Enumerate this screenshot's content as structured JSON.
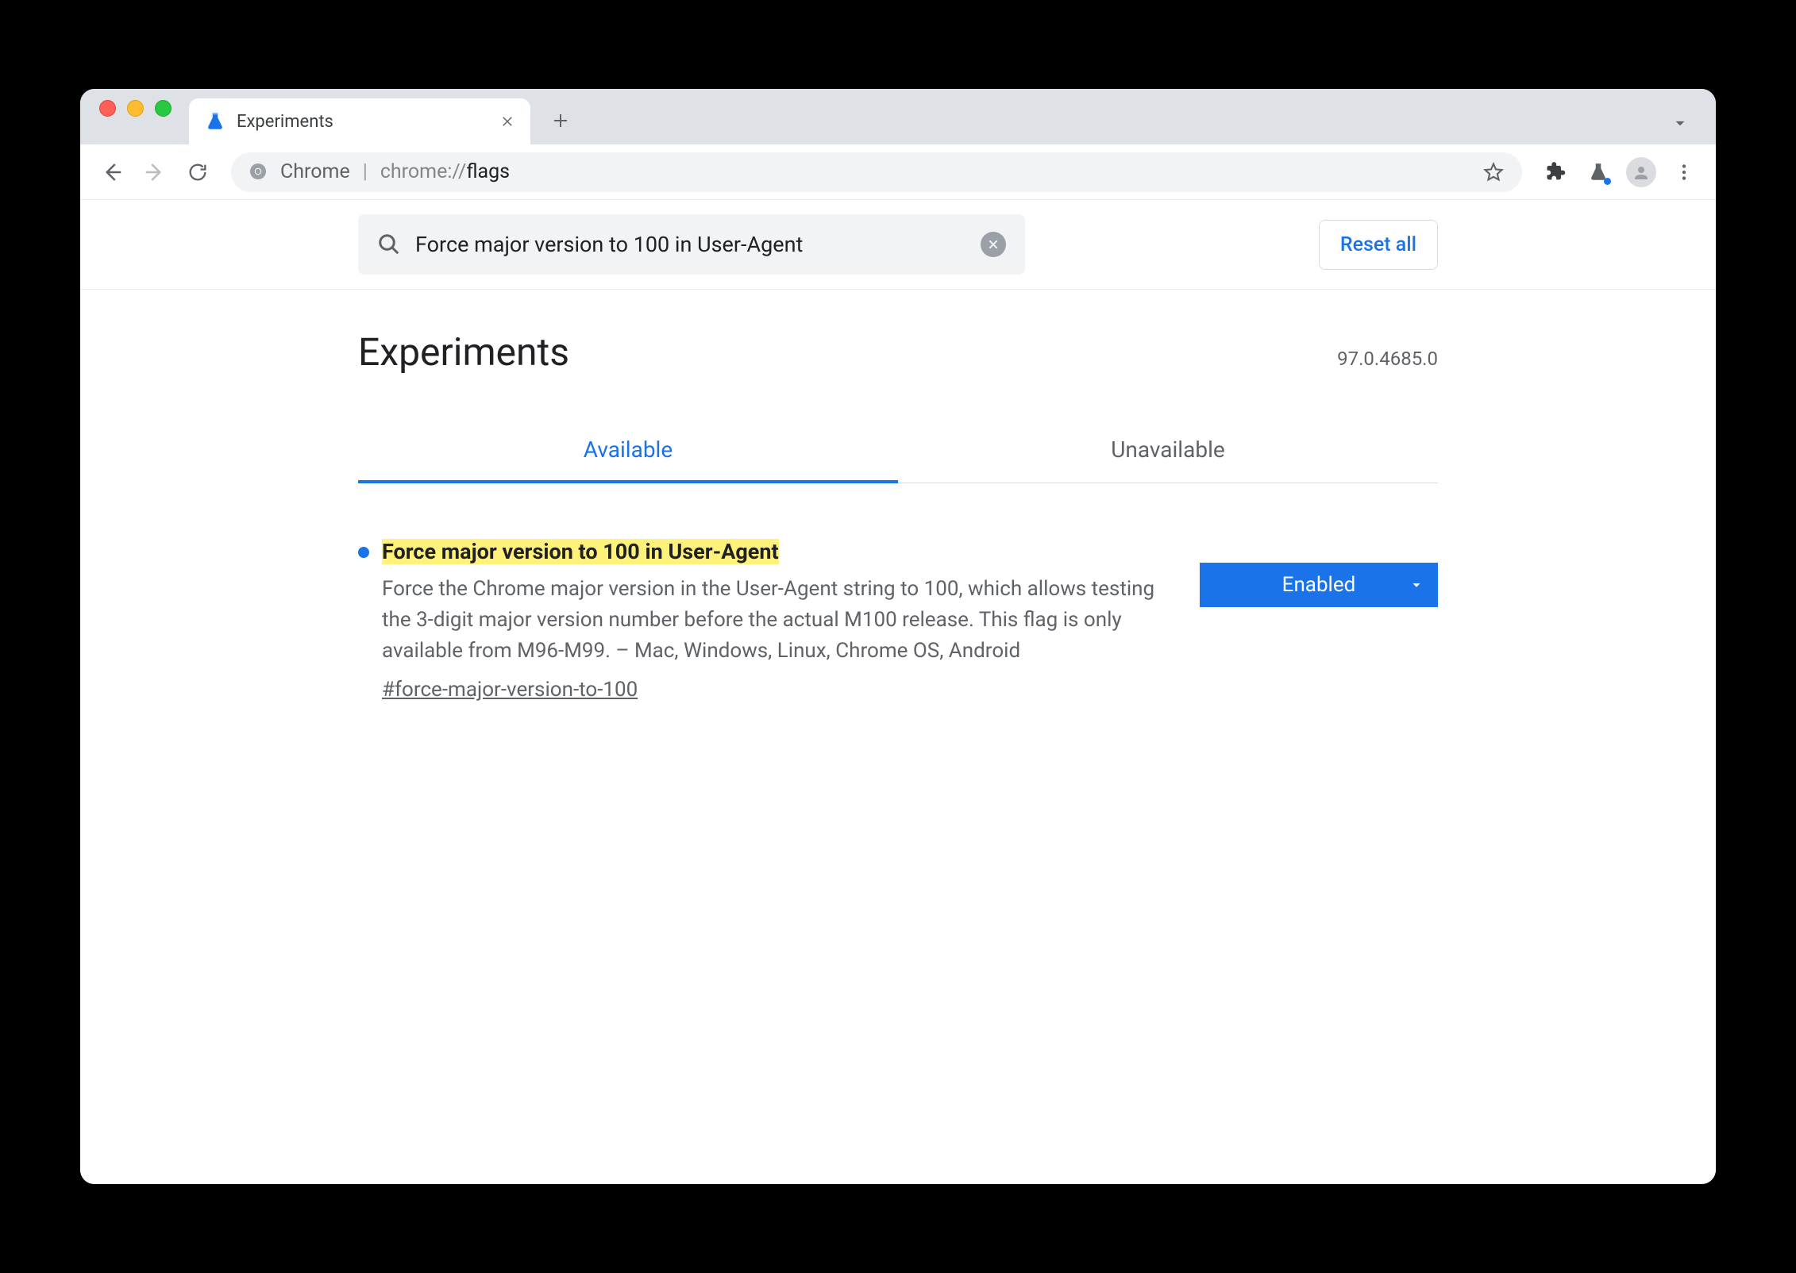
{
  "browser": {
    "tab_title": "Experiments",
    "omnibox_label": "Chrome",
    "omnibox_url_prefix": "chrome://",
    "omnibox_url_path": "flags"
  },
  "search": {
    "value": "Force major version to 100 in User-Agent",
    "reset_label": "Reset all"
  },
  "page": {
    "title": "Experiments",
    "version": "97.0.4685.0"
  },
  "tabs": {
    "available": "Available",
    "unavailable": "Unavailable"
  },
  "flag": {
    "title": "Force major version to 100 in User-Agent",
    "description": "Force the Chrome major version in the User-Agent string to 100, which allows testing the 3-digit major version number before the actual M100 release. This flag is only available from M96-M99. – Mac, Windows, Linux, Chrome OS, Android",
    "hash": "#force-major-version-to-100",
    "select_value": "Enabled"
  }
}
